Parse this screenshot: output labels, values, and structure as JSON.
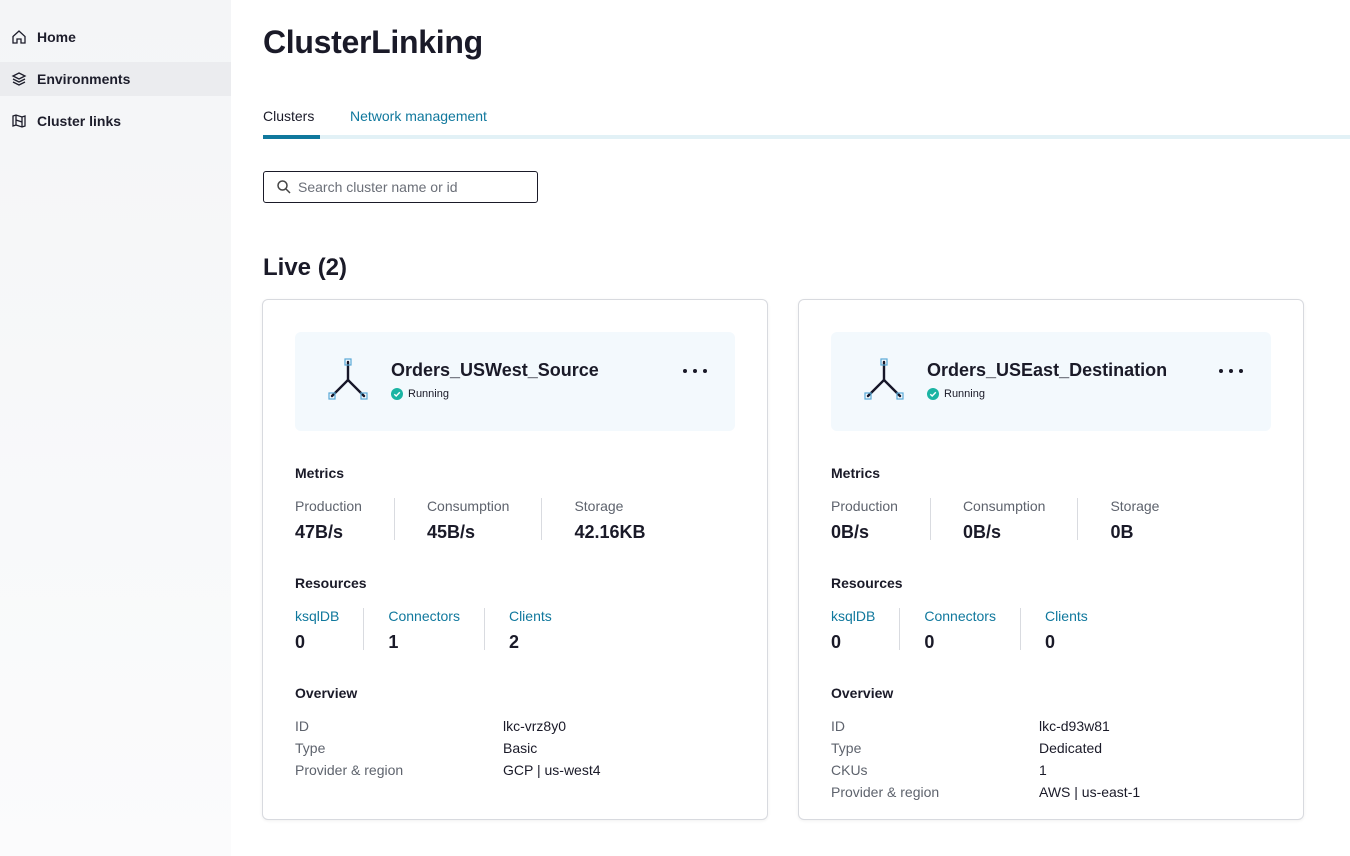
{
  "sidebar": {
    "items": [
      {
        "label": "Home",
        "icon": "home-icon"
      },
      {
        "label": "Environments",
        "icon": "layers-icon"
      },
      {
        "label": "Cluster links",
        "icon": "cluster-link-icon"
      }
    ]
  },
  "page": {
    "title": "ClusterLinking"
  },
  "tabs": [
    {
      "label": "Clusters",
      "active": true
    },
    {
      "label": "Network management",
      "active": false
    }
  ],
  "search": {
    "placeholder": "Search cluster name or id",
    "value": ""
  },
  "section": {
    "title": "Live (2)"
  },
  "labels": {
    "metrics": "Metrics",
    "resources": "Resources",
    "overview": "Overview"
  },
  "colors": {
    "accent": "#10789d",
    "running": "#1bb4a3",
    "card_header_bg": "#f3f9fd"
  },
  "clusters": [
    {
      "name": "Orders_USWest_Source",
      "status": "Running",
      "metrics": [
        {
          "label": "Production",
          "value": "47B/s"
        },
        {
          "label": "Consumption",
          "value": "45B/s"
        },
        {
          "label": "Storage",
          "value": "42.16KB"
        }
      ],
      "resources": [
        {
          "label": "ksqlDB",
          "value": "0"
        },
        {
          "label": "Connectors",
          "value": "1"
        },
        {
          "label": "Clients",
          "value": "2"
        }
      ],
      "overview": [
        {
          "key": "ID",
          "value": "lkc-vrz8y0"
        },
        {
          "key": "Type",
          "value": "Basic"
        },
        {
          "key": "Provider & region",
          "value": "GCP | us-west4"
        }
      ]
    },
    {
      "name": "Orders_USEast_Destination",
      "status": "Running",
      "metrics": [
        {
          "label": "Production",
          "value": "0B/s"
        },
        {
          "label": "Consumption",
          "value": "0B/s"
        },
        {
          "label": "Storage",
          "value": "0B"
        }
      ],
      "resources": [
        {
          "label": "ksqlDB",
          "value": "0"
        },
        {
          "label": "Connectors",
          "value": "0"
        },
        {
          "label": "Clients",
          "value": "0"
        }
      ],
      "overview": [
        {
          "key": "ID",
          "value": "lkc-d93w81"
        },
        {
          "key": "Type",
          "value": "Dedicated"
        },
        {
          "key": "CKUs",
          "value": "1"
        },
        {
          "key": "Provider & region",
          "value": "AWS | us-east-1"
        }
      ]
    }
  ]
}
